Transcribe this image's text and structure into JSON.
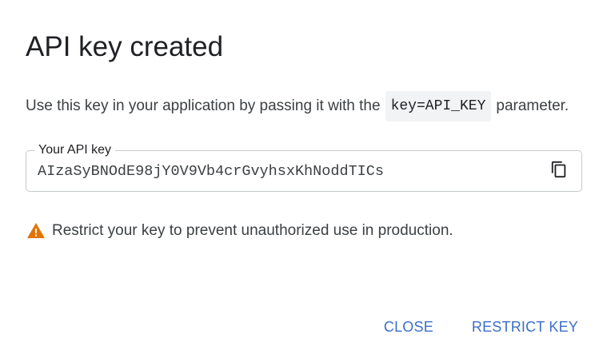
{
  "dialog": {
    "title": "API key created",
    "description": {
      "prefix": "Use this key in your application by passing it with the",
      "code": "key=API_KEY",
      "suffix": "parameter."
    },
    "key_field": {
      "label": "Your API key",
      "value": "AIzaSyBNOdE98jY0V9Vb4crGvyhsxKhNoddTICs",
      "copy_icon": "copy-icon"
    },
    "warning": {
      "icon": "warning-icon",
      "text": "Restrict your key to prevent unauthorized use in production."
    },
    "actions": {
      "close_label": "CLOSE",
      "restrict_label": "RESTRICT KEY"
    }
  },
  "colors": {
    "accent": "#3b6fc8",
    "warning": "#e37400",
    "text": "#202124",
    "border": "#c6c9cc"
  }
}
